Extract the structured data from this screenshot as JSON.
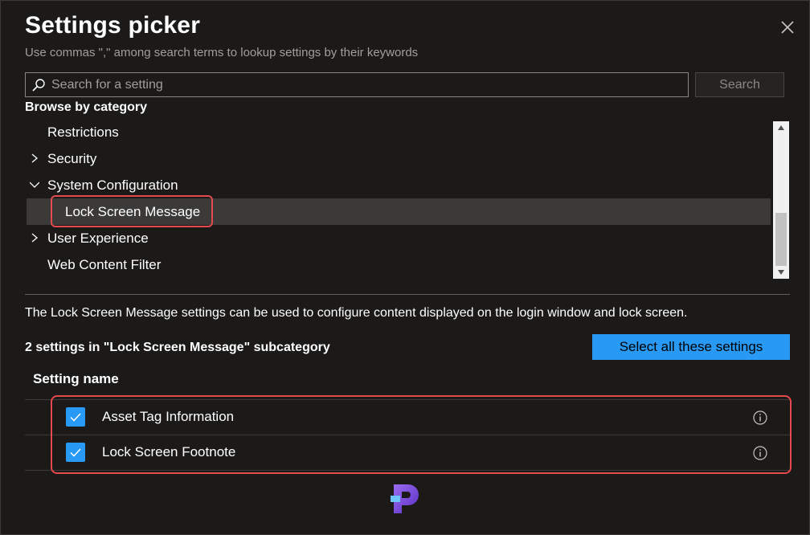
{
  "header": {
    "title": "Settings picker",
    "subtitle": "Use commas \",\" among search terms to lookup settings by their keywords"
  },
  "search": {
    "placeholder": "Search for a setting",
    "value": "",
    "button_label": "Search"
  },
  "browse": {
    "label": "Browse by category",
    "items": [
      {
        "label": "Restrictions",
        "chevron": "none"
      },
      {
        "label": "Security",
        "chevron": "right"
      },
      {
        "label": "System Configuration",
        "chevron": "down"
      },
      {
        "label": "Lock Screen Message",
        "chevron": "none",
        "selected": true
      },
      {
        "label": "User Experience",
        "chevron": "right"
      },
      {
        "label": "Web Content Filter",
        "chevron": "none"
      }
    ]
  },
  "details": {
    "description": "The Lock Screen Message settings can be used to configure content displayed on the login window and lock screen.",
    "count_text": "2 settings in \"Lock Screen Message\" subcategory",
    "select_all_label": "Select all these settings",
    "column_header": "Setting name",
    "settings": [
      {
        "name": "Asset Tag Information",
        "checked": true
      },
      {
        "name": "Lock Screen Footnote",
        "checked": true
      }
    ]
  },
  "colors": {
    "background": "#1b1a19",
    "accent": "#2899f5",
    "highlight": "#e5484d",
    "logo": "#7b4fd6"
  }
}
